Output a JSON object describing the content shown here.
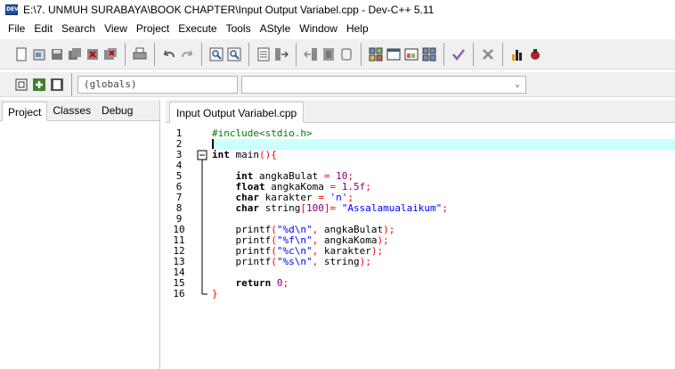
{
  "window": {
    "title": "E:\\7. UNMUH SURABAYA\\BOOK CHAPTER\\Input Output Variabel.cpp - Dev-C++ 5.11",
    "icon_label": "DEV"
  },
  "menu": [
    "File",
    "Edit",
    "Search",
    "View",
    "Project",
    "Execute",
    "Tools",
    "AStyle",
    "Window",
    "Help"
  ],
  "toolbar": {
    "icons": [
      "new-file-icon",
      "open-icon",
      "save-icon",
      "save-all-icon",
      "close-icon",
      "close-all-icon",
      "print-icon",
      "undo-icon",
      "redo-icon",
      "find-icon",
      "replace-icon",
      "goto-icon",
      "indent-icon",
      "unindent-icon",
      "toggle-comment-icon",
      "compile-icon",
      "run-icon",
      "compile-run-icon",
      "rebuild-icon",
      "syntax-check-icon",
      "stop-icon",
      "profile-icon",
      "debug-icon"
    ]
  },
  "scope_combo": {
    "value": "(globals)"
  },
  "left_tabs": [
    "Project",
    "Classes",
    "Debug"
  ],
  "editor": {
    "tab": "Input Output Variabel.cpp",
    "current_line": 2,
    "lines": [
      {
        "n": "1",
        "code": [
          {
            "t": "#include<stdio.h>",
            "c": "pp"
          }
        ]
      },
      {
        "n": "2",
        "code": [],
        "caret": true
      },
      {
        "n": "3",
        "code": [
          {
            "t": "int",
            "c": "kw"
          },
          {
            "t": " main",
            "c": "id"
          },
          {
            "t": "(){",
            "c": "op"
          }
        ],
        "fold": "open"
      },
      {
        "n": "4",
        "code": []
      },
      {
        "n": "5",
        "code": [
          {
            "t": "    int",
            "c": "kw"
          },
          {
            "t": " angkaBulat ",
            "c": "id"
          },
          {
            "t": "=",
            "c": "op"
          },
          {
            "t": " ",
            "c": "id"
          },
          {
            "t": "10",
            "c": "num"
          },
          {
            "t": ";",
            "c": "op"
          }
        ]
      },
      {
        "n": "6",
        "code": [
          {
            "t": "    float",
            "c": "kw"
          },
          {
            "t": " angkaKoma ",
            "c": "id"
          },
          {
            "t": "=",
            "c": "op"
          },
          {
            "t": " ",
            "c": "id"
          },
          {
            "t": "1.5f",
            "c": "num"
          },
          {
            "t": ";",
            "c": "op"
          }
        ]
      },
      {
        "n": "7",
        "code": [
          {
            "t": "    char",
            "c": "kw"
          },
          {
            "t": " karakter ",
            "c": "id"
          },
          {
            "t": "=",
            "c": "op"
          },
          {
            "t": " ",
            "c": "id"
          },
          {
            "t": "'n'",
            "c": "str"
          },
          {
            "t": ";",
            "c": "op"
          }
        ]
      },
      {
        "n": "8",
        "code": [
          {
            "t": "    char",
            "c": "kw"
          },
          {
            "t": " string",
            "c": "id"
          },
          {
            "t": "[",
            "c": "op"
          },
          {
            "t": "100",
            "c": "num"
          },
          {
            "t": "]=",
            "c": "op"
          },
          {
            "t": " ",
            "c": "id"
          },
          {
            "t": "\"Assalamualaikum\"",
            "c": "str"
          },
          {
            "t": ";",
            "c": "op"
          }
        ]
      },
      {
        "n": "9",
        "code": []
      },
      {
        "n": "10",
        "code": [
          {
            "t": "    printf",
            "c": "id"
          },
          {
            "t": "(",
            "c": "op"
          },
          {
            "t": "\"%d\\n\"",
            "c": "str"
          },
          {
            "t": ",",
            "c": "op"
          },
          {
            "t": " angkaBulat",
            "c": "id"
          },
          {
            "t": ");",
            "c": "op"
          }
        ]
      },
      {
        "n": "11",
        "code": [
          {
            "t": "    printf",
            "c": "id"
          },
          {
            "t": "(",
            "c": "op"
          },
          {
            "t": "\"%f\\n\"",
            "c": "str"
          },
          {
            "t": ",",
            "c": "op"
          },
          {
            "t": " angkaKoma",
            "c": "id"
          },
          {
            "t": ");",
            "c": "op"
          }
        ]
      },
      {
        "n": "12",
        "code": [
          {
            "t": "    printf",
            "c": "id"
          },
          {
            "t": "(",
            "c": "op"
          },
          {
            "t": "\"%c\\n\"",
            "c": "str"
          },
          {
            "t": ",",
            "c": "op"
          },
          {
            "t": " karakter",
            "c": "id"
          },
          {
            "t": ");",
            "c": "op"
          }
        ]
      },
      {
        "n": "13",
        "code": [
          {
            "t": "    printf",
            "c": "id"
          },
          {
            "t": "(",
            "c": "op"
          },
          {
            "t": "\"%s\\n\"",
            "c": "str"
          },
          {
            "t": ",",
            "c": "op"
          },
          {
            "t": " string",
            "c": "id"
          },
          {
            "t": ");",
            "c": "op"
          }
        ]
      },
      {
        "n": "14",
        "code": []
      },
      {
        "n": "15",
        "code": [
          {
            "t": "    return",
            "c": "kw"
          },
          {
            "t": " ",
            "c": "id"
          },
          {
            "t": "0",
            "c": "num"
          },
          {
            "t": ";",
            "c": "op"
          }
        ]
      },
      {
        "n": "16",
        "code": [
          {
            "t": "}",
            "c": "op"
          }
        ],
        "fold": "end"
      }
    ]
  }
}
